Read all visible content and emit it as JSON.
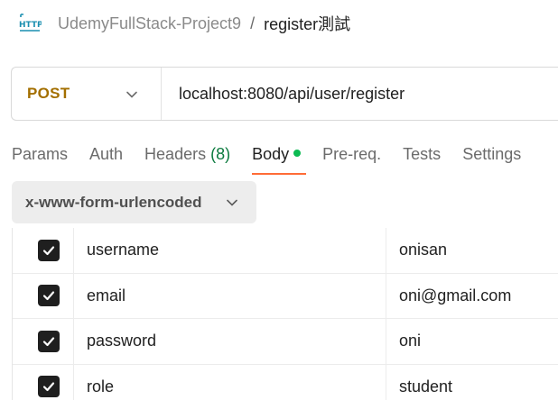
{
  "breadcrumb": {
    "icon": "http-icon",
    "collection": "UdemyFullStack-Project9",
    "separator": "/",
    "request": "register測試"
  },
  "request": {
    "method": "POST",
    "url": "localhost:8080/api/user/register"
  },
  "tabs": [
    {
      "label": "Params"
    },
    {
      "label": "Auth"
    },
    {
      "label": "Headers",
      "count": "(8)"
    },
    {
      "label": "Body",
      "active": true
    },
    {
      "label": "Pre-req."
    },
    {
      "label": "Tests"
    },
    {
      "label": "Settings"
    }
  ],
  "body": {
    "type": "x-www-form-urlencoded",
    "rows": [
      {
        "checked": true,
        "key": "username",
        "value": "onisan"
      },
      {
        "checked": true,
        "key": "email",
        "value": "oni@gmail.com"
      },
      {
        "checked": true,
        "key": "password",
        "value": "oni"
      },
      {
        "checked": true,
        "key": "role",
        "value": "student"
      }
    ]
  },
  "colors": {
    "method": "#a36f00",
    "active_tab_underline": "#ff6c37",
    "body_dot": "#0cbb52",
    "headers_count": "#0b7a3e",
    "http_icon": "#1a8fb0"
  }
}
